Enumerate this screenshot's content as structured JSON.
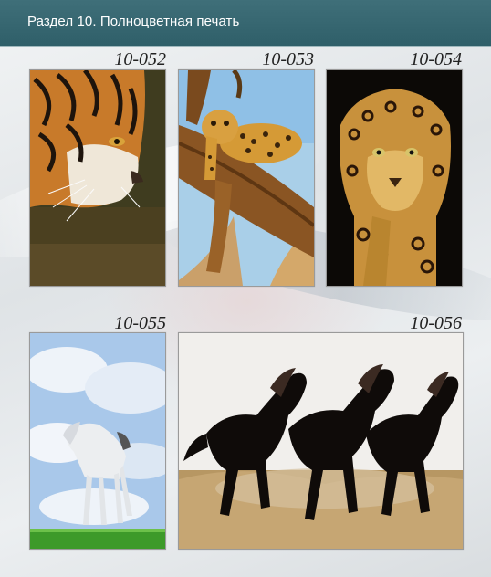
{
  "header": {
    "title": "Раздел 10. Полноцветная печать"
  },
  "items": [
    {
      "code": "10-052",
      "subject": "tiger"
    },
    {
      "code": "10-053",
      "subject": "leopard-on-branch"
    },
    {
      "code": "10-054",
      "subject": "jaguar"
    },
    {
      "code": "10-055",
      "subject": "white-horse"
    },
    {
      "code": "10-056",
      "subject": "three-black-horses"
    }
  ]
}
